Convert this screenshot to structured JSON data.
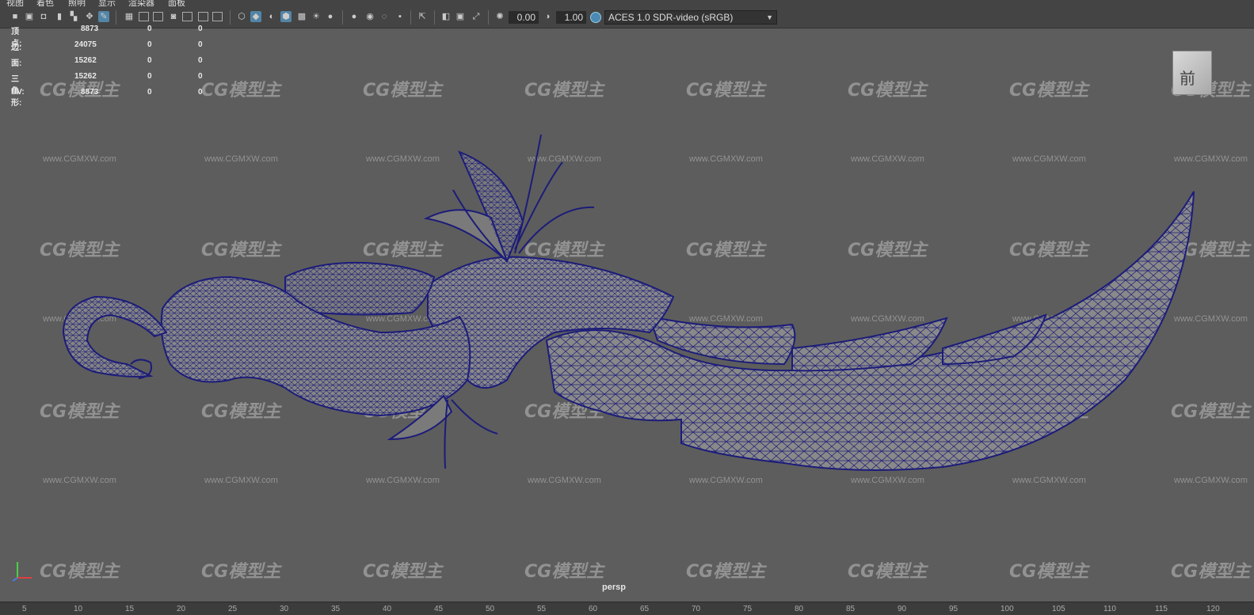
{
  "menu": [
    "视图",
    "着色",
    "照明",
    "显示",
    "渲染器",
    "面板"
  ],
  "toolbar": {
    "exposure": "0.00",
    "gamma": "1.00",
    "color_space": "ACES 1.0 SDR-video (sRGB)"
  },
  "hud": [
    {
      "label": "顶点:",
      "a": "8873",
      "b": "0",
      "c": "0"
    },
    {
      "label": "边:",
      "a": "24075",
      "b": "0",
      "c": "0"
    },
    {
      "label": "面:",
      "a": "15262",
      "b": "0",
      "c": "0"
    },
    {
      "label": "三角形:",
      "a": "15262",
      "b": "0",
      "c": "0"
    },
    {
      "label": "UV:",
      "a": "8873",
      "b": "0",
      "c": "0"
    }
  ],
  "viewcube_face": "前",
  "camera": "persp",
  "watermark": {
    "logo": "CG模型主",
    "url": "www.CGMXW.com"
  },
  "timeline_ticks": [
    "5",
    "10",
    "15",
    "20",
    "25",
    "30",
    "35",
    "40",
    "45",
    "50",
    "55",
    "60",
    "65",
    "70",
    "75",
    "80",
    "85",
    "90",
    "95",
    "100",
    "105",
    "110",
    "115",
    "120"
  ],
  "colors": {
    "wire": "#1c1c7a",
    "viewport": "#5d5d5d",
    "accent": "#5285a6"
  }
}
